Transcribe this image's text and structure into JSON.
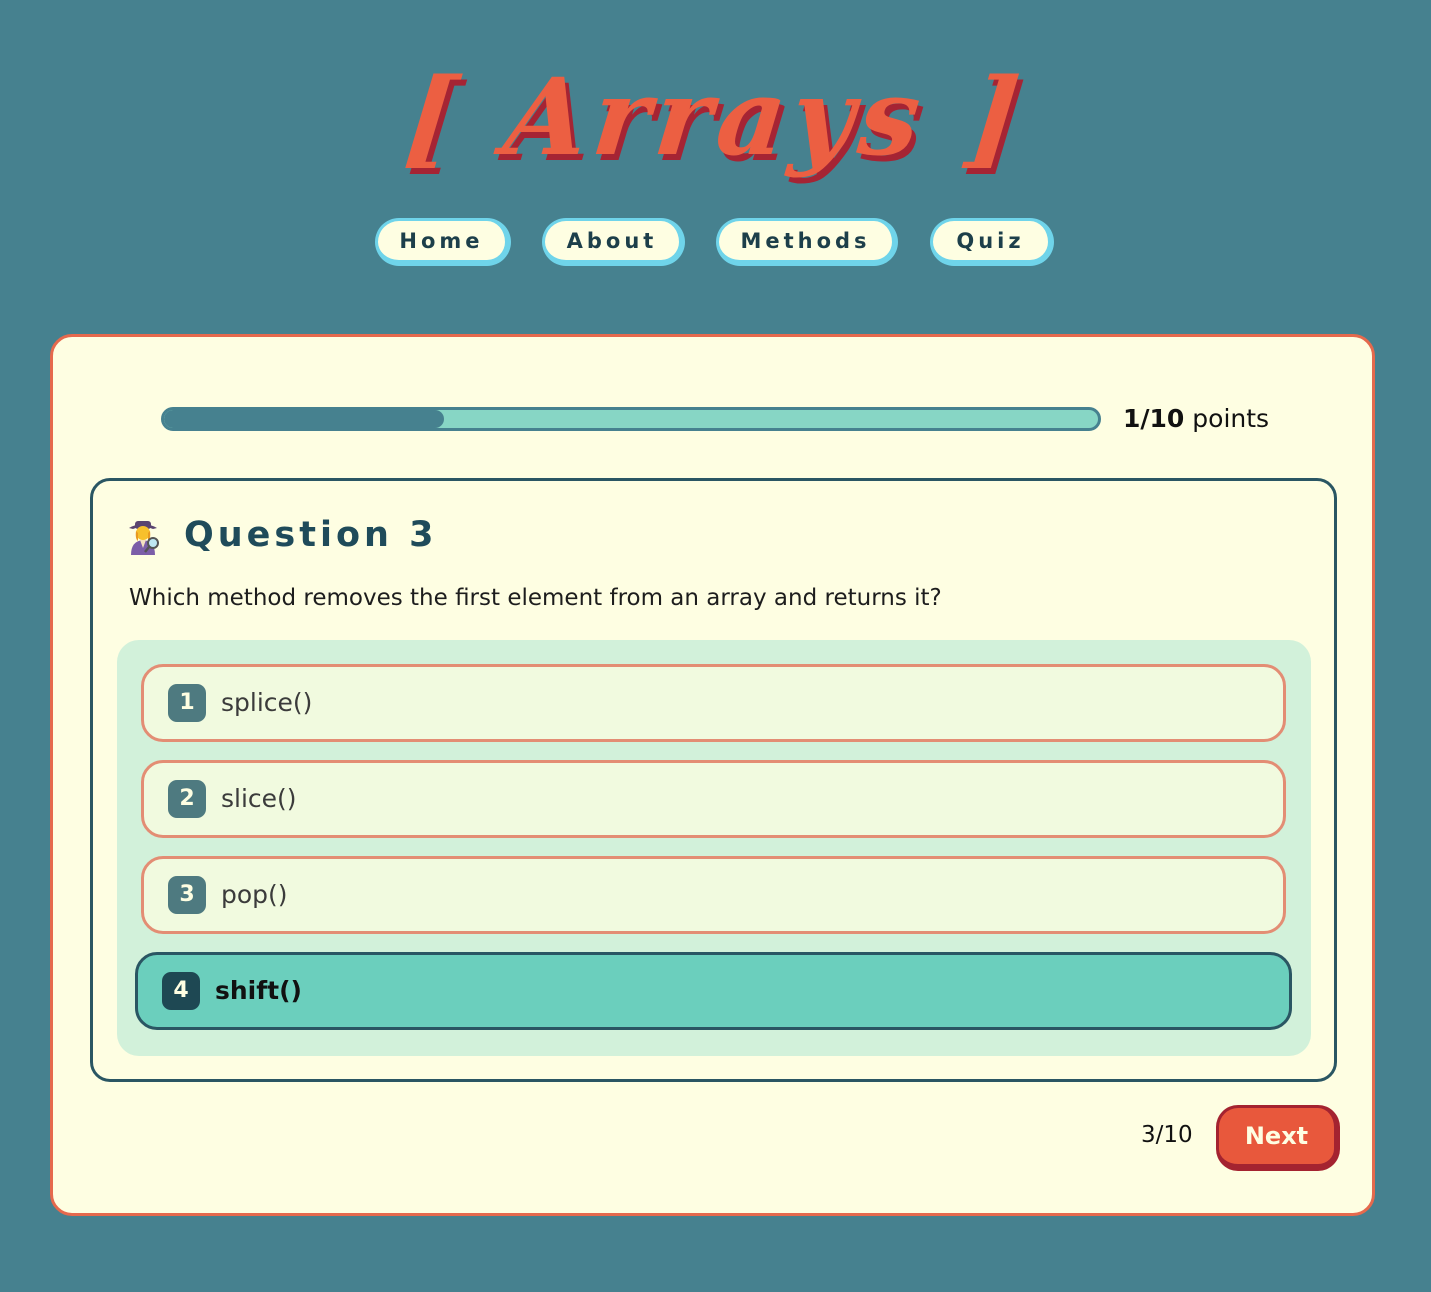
{
  "logo": "[ Arrays ]",
  "nav": {
    "items": [
      {
        "label": "Home"
      },
      {
        "label": "About"
      },
      {
        "label": "Methods"
      },
      {
        "label": "Quiz"
      }
    ]
  },
  "progress": {
    "fraction": 0.3,
    "score": "1/10",
    "unit": "points"
  },
  "question": {
    "icon": "detective-emoji-icon",
    "title": "Question 3",
    "text": "Which method removes the first element from an array and returns it?",
    "options": [
      {
        "number": "1",
        "label": "splice()",
        "selected": false
      },
      {
        "number": "2",
        "label": "slice()",
        "selected": false
      },
      {
        "number": "3",
        "label": "pop()",
        "selected": false
      },
      {
        "number": "4",
        "label": "shift()",
        "selected": true
      }
    ]
  },
  "footer": {
    "counter": "3/10",
    "next_label": "Next"
  },
  "colors": {
    "background": "#46818f",
    "accent": "#ec5f42",
    "card": "#fefee2",
    "selected_option": "#6bcfbd"
  }
}
